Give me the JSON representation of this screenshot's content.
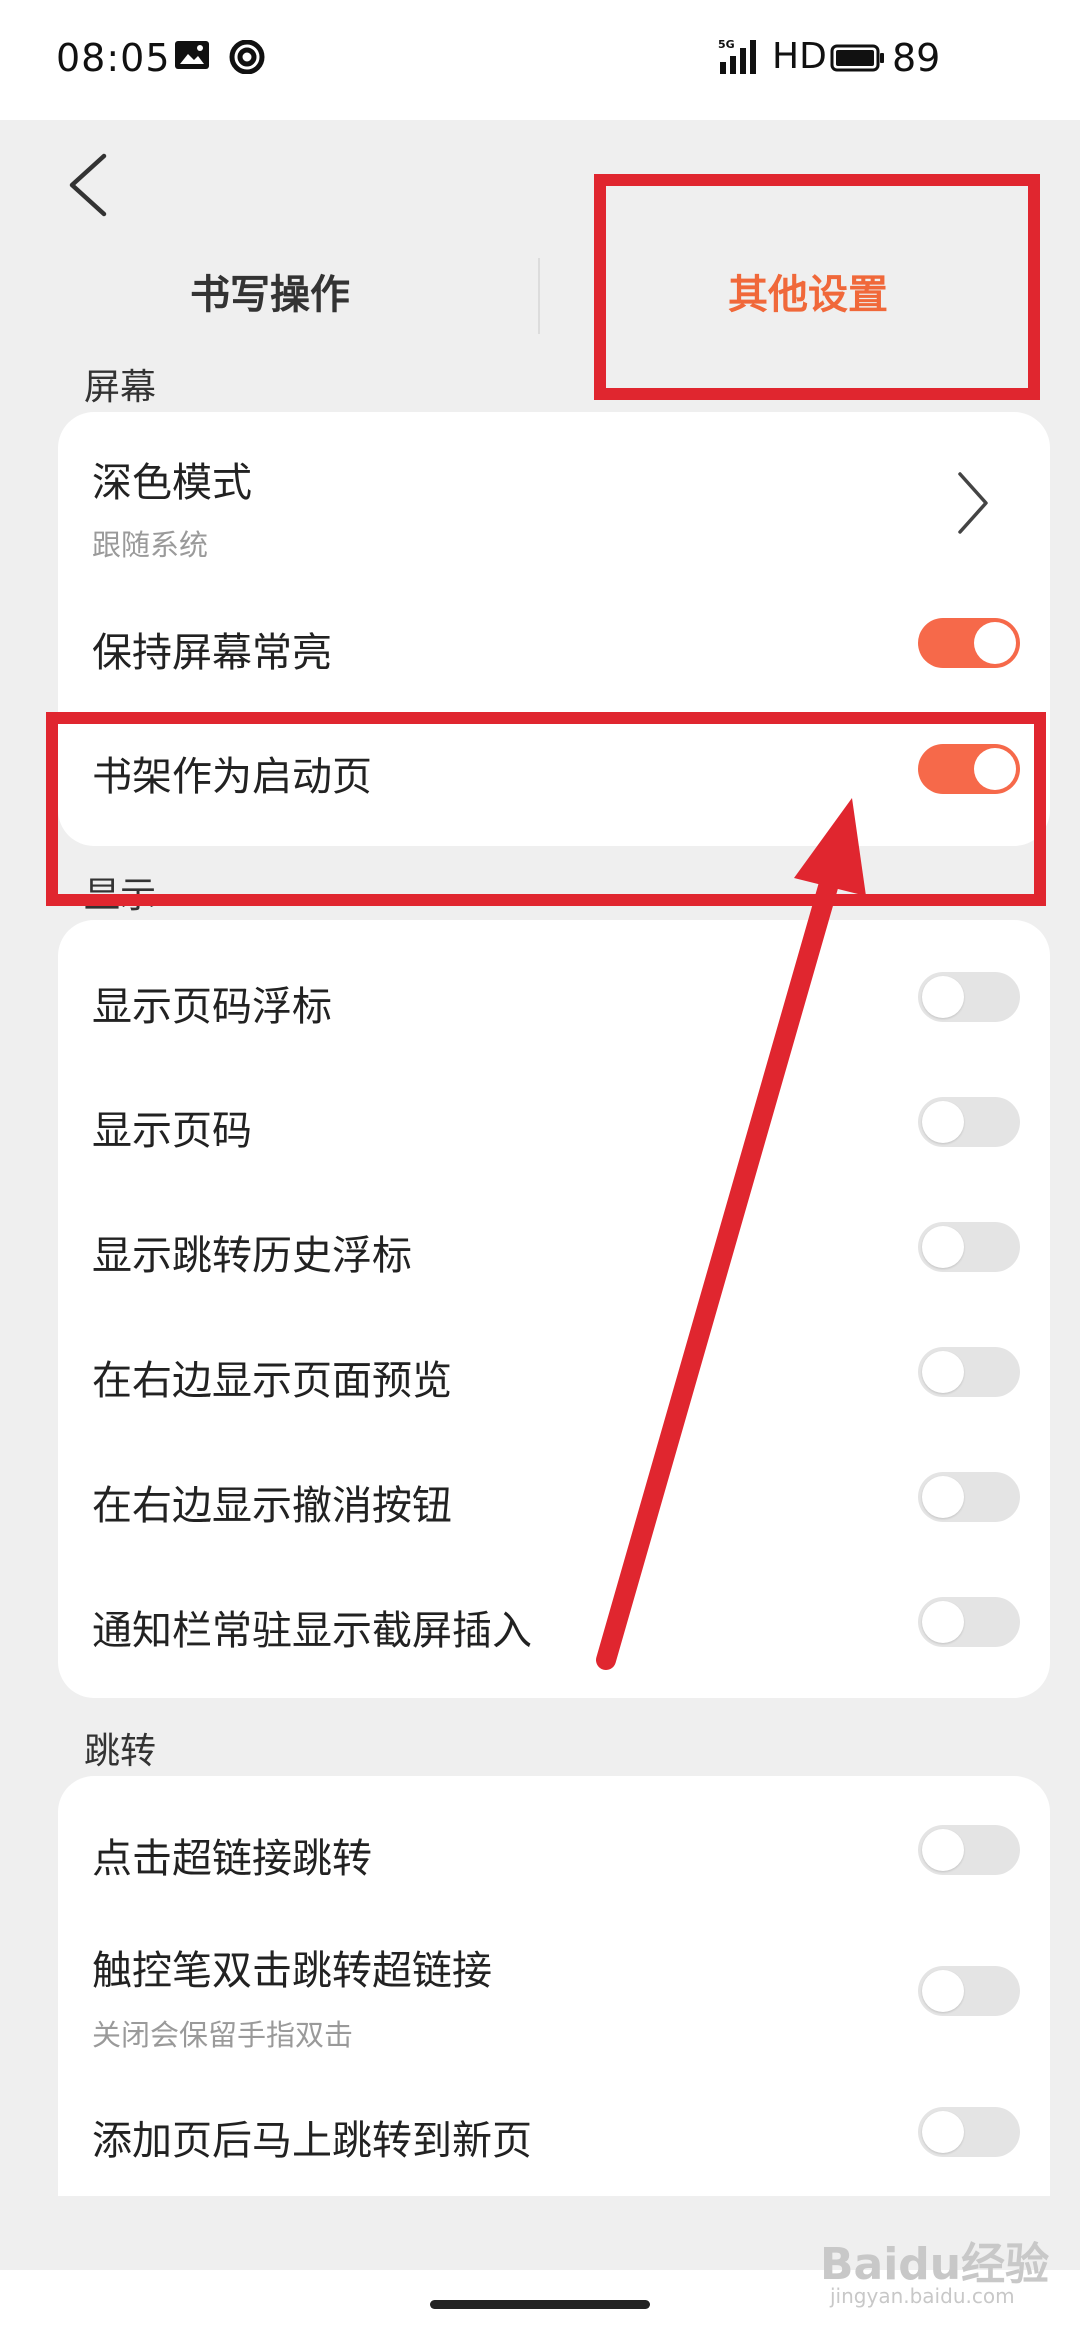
{
  "status_bar": {
    "time": "08:05",
    "network": "HD",
    "battery": "89",
    "icons": [
      "image-icon",
      "hotspot-icon",
      "signal-5g-icon",
      "battery-icon"
    ]
  },
  "tabs": [
    {
      "label": "书写操作",
      "active": false
    },
    {
      "label": "其他设置",
      "active": true
    }
  ],
  "sections": {
    "screen": {
      "header": "屏幕",
      "items": [
        {
          "label": "深色模式",
          "sub": "跟随系统",
          "type": "link"
        },
        {
          "label": "保持屏幕常亮",
          "type": "toggle",
          "on": true
        },
        {
          "label": "书架作为启动页",
          "type": "toggle",
          "on": true
        }
      ]
    },
    "display": {
      "header": "显示",
      "items": [
        {
          "label": "显示页码浮标",
          "on": false
        },
        {
          "label": "显示页码",
          "on": false
        },
        {
          "label": "显示跳转历史浮标",
          "on": false
        },
        {
          "label": "在右边显示页面预览",
          "on": false
        },
        {
          "label": "在右边显示撤消按钮",
          "on": false
        },
        {
          "label": "通知栏常驻显示截屏插入",
          "on": false
        }
      ]
    },
    "jump": {
      "header": "跳转",
      "items": [
        {
          "label": "点击超链接跳转",
          "on": false
        },
        {
          "label": "触控笔双击跳转超链接",
          "sub": "关闭会保留手指双击",
          "on": false
        },
        {
          "label": "添加页后马上跳转到新页",
          "on": false
        }
      ]
    }
  },
  "colors": {
    "accent": "#f0683a",
    "toggle_on": "#f6694a",
    "toggle_off": "#e4e4e4",
    "annotation": "#e0262f"
  },
  "watermark": {
    "brand": "Baidu经验",
    "site": "jingyan.baidu.com"
  }
}
